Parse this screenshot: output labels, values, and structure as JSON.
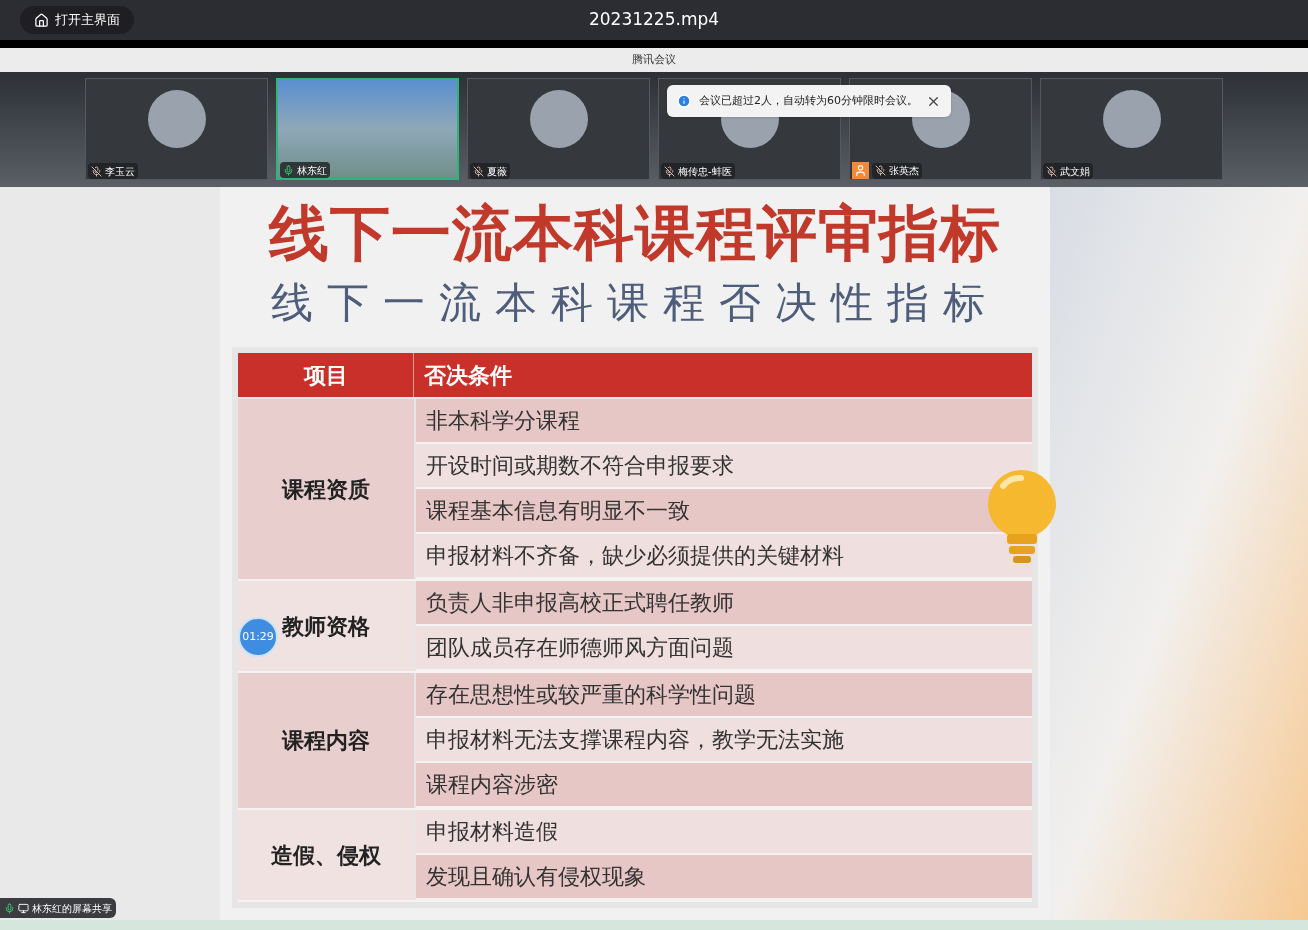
{
  "player": {
    "home_button": "打开主界面",
    "file_name": "20231225.mp4"
  },
  "meeting": {
    "app_title": "腾讯会议",
    "participants": [
      {
        "name": "李玉云",
        "kind": "avatar",
        "muted": true,
        "speaking": false,
        "role_icon": false
      },
      {
        "name": "林东红",
        "kind": "video",
        "muted": false,
        "speaking": true,
        "role_icon": false
      },
      {
        "name": "夏薇",
        "kind": "avatar",
        "muted": true,
        "speaking": false,
        "role_icon": false
      },
      {
        "name": "梅传忠-蚌医",
        "kind": "avatar",
        "muted": true,
        "speaking": false,
        "role_icon": false
      },
      {
        "name": "张英杰",
        "kind": "avatar",
        "muted": true,
        "speaking": false,
        "role_icon": true
      },
      {
        "name": "武文娟",
        "kind": "avatar",
        "muted": true,
        "speaking": false,
        "role_icon": false
      }
    ],
    "toast": {
      "message": "会议已超过2人，自动转为60分钟限时会议。"
    }
  },
  "slide": {
    "title": "线下一流本科课程评审指标",
    "subtitle": "线下一流本科课程否决性指标",
    "table": {
      "columns": [
        "项目",
        "否决条件"
      ],
      "groups": [
        {
          "category": "课程资质",
          "conditions": [
            "非本科学分课程",
            "开设时间或期数不符合申报要求",
            "课程基本信息有明显不一致",
            "申报材料不齐备，缺少必须提供的关键材料"
          ]
        },
        {
          "category": "教师资格",
          "conditions": [
            "负责人非申报高校正式聘任教师",
            "团队成员存在师德师风方面问题"
          ]
        },
        {
          "category": "课程内容",
          "conditions": [
            "存在思想性或较严重的科学性问题",
            "申报材料无法支撑课程内容，教学无法实施",
            "课程内容涉密"
          ]
        },
        {
          "category": "造假、侵权",
          "conditions": [
            "申报材料造假",
            "发现且确认有侵权现象"
          ]
        }
      ]
    },
    "timer": "01:29"
  },
  "share_label": "林东红的屏幕共享"
}
